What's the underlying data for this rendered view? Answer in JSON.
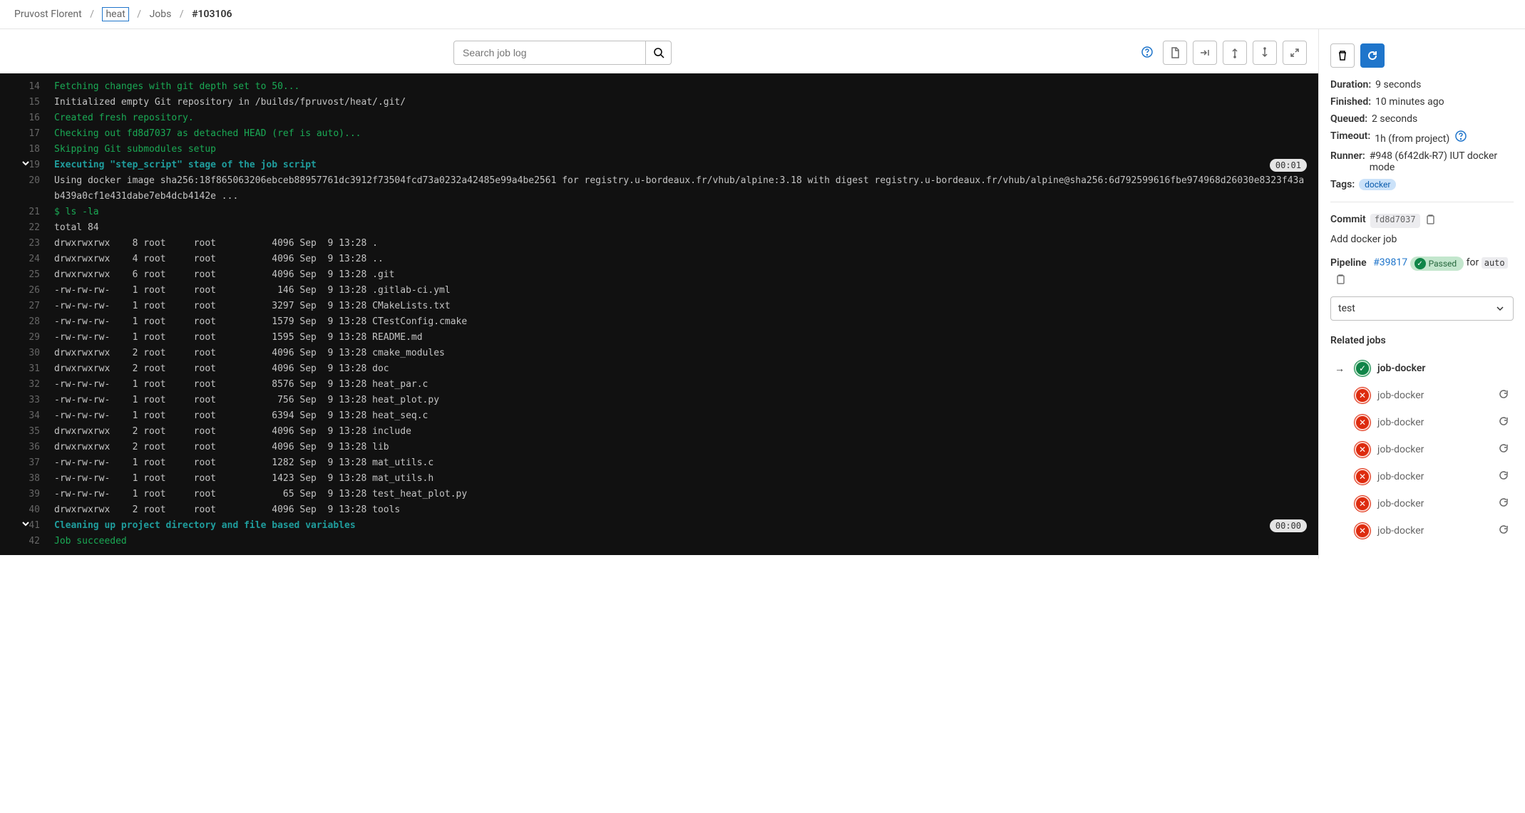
{
  "breadcrumb": {
    "owner": "Pruvost Florent",
    "project": "heat",
    "section": "Jobs",
    "job_id": "#103106"
  },
  "toolbar": {
    "search_placeholder": "Search job log"
  },
  "log": {
    "lines": [
      {
        "n": "14",
        "text": "Fetching changes with git depth set to 50...",
        "cls": "log-green",
        "chevron": false
      },
      {
        "n": "15",
        "text": "Initialized empty Git repository in /builds/fpruvost/heat/.git/",
        "cls": "",
        "chevron": false
      },
      {
        "n": "16",
        "text": "Created fresh repository.",
        "cls": "log-green",
        "chevron": false
      },
      {
        "n": "17",
        "text": "Checking out fd8d7037 as detached HEAD (ref is auto)...",
        "cls": "log-green",
        "chevron": false
      },
      {
        "n": "18",
        "text": "Skipping Git submodules setup",
        "cls": "log-green",
        "chevron": false
      },
      {
        "n": "19",
        "text": "Executing \"step_script\" stage of the job script",
        "cls": "log-cyan",
        "chevron": true,
        "duration": "00:01"
      },
      {
        "n": "20",
        "text": "Using docker image sha256:18f865063206ebceb88957761dc3912f73504fcd73a0232a42485e99a4be2561 for registry.u-bordeaux.fr/vhub/alpine:3.18 with digest registry.u-bordeaux.fr/vhub/alpine@sha256:6d792599616fbe974968d26030e8323f43ab439a0cf1e431dabe7eb4dcb4142e ...",
        "cls": "",
        "chevron": false
      },
      {
        "n": "21",
        "text": "$ ls -la",
        "cls": "log-green",
        "chevron": false
      },
      {
        "n": "22",
        "text": "total 84",
        "cls": "",
        "chevron": false
      },
      {
        "n": "23",
        "text": "drwxrwxrwx    8 root     root          4096 Sep  9 13:28 .",
        "cls": "",
        "chevron": false
      },
      {
        "n": "24",
        "text": "drwxrwxrwx    4 root     root          4096 Sep  9 13:28 ..",
        "cls": "",
        "chevron": false
      },
      {
        "n": "25",
        "text": "drwxrwxrwx    6 root     root          4096 Sep  9 13:28 .git",
        "cls": "",
        "chevron": false
      },
      {
        "n": "26",
        "text": "-rw-rw-rw-    1 root     root           146 Sep  9 13:28 .gitlab-ci.yml",
        "cls": "",
        "chevron": false
      },
      {
        "n": "27",
        "text": "-rw-rw-rw-    1 root     root          3297 Sep  9 13:28 CMakeLists.txt",
        "cls": "",
        "chevron": false
      },
      {
        "n": "28",
        "text": "-rw-rw-rw-    1 root     root          1579 Sep  9 13:28 CTestConfig.cmake",
        "cls": "",
        "chevron": false
      },
      {
        "n": "29",
        "text": "-rw-rw-rw-    1 root     root          1595 Sep  9 13:28 README.md",
        "cls": "",
        "chevron": false
      },
      {
        "n": "30",
        "text": "drwxrwxrwx    2 root     root          4096 Sep  9 13:28 cmake_modules",
        "cls": "",
        "chevron": false
      },
      {
        "n": "31",
        "text": "drwxrwxrwx    2 root     root          4096 Sep  9 13:28 doc",
        "cls": "",
        "chevron": false
      },
      {
        "n": "32",
        "text": "-rw-rw-rw-    1 root     root          8576 Sep  9 13:28 heat_par.c",
        "cls": "",
        "chevron": false
      },
      {
        "n": "33",
        "text": "-rw-rw-rw-    1 root     root           756 Sep  9 13:28 heat_plot.py",
        "cls": "",
        "chevron": false
      },
      {
        "n": "34",
        "text": "-rw-rw-rw-    1 root     root          6394 Sep  9 13:28 heat_seq.c",
        "cls": "",
        "chevron": false
      },
      {
        "n": "35",
        "text": "drwxrwxrwx    2 root     root          4096 Sep  9 13:28 include",
        "cls": "",
        "chevron": false
      },
      {
        "n": "36",
        "text": "drwxrwxrwx    2 root     root          4096 Sep  9 13:28 lib",
        "cls": "",
        "chevron": false
      },
      {
        "n": "37",
        "text": "-rw-rw-rw-    1 root     root          1282 Sep  9 13:28 mat_utils.c",
        "cls": "",
        "chevron": false
      },
      {
        "n": "38",
        "text": "-rw-rw-rw-    1 root     root          1423 Sep  9 13:28 mat_utils.h",
        "cls": "",
        "chevron": false
      },
      {
        "n": "39",
        "text": "-rw-rw-rw-    1 root     root            65 Sep  9 13:28 test_heat_plot.py",
        "cls": "",
        "chevron": false
      },
      {
        "n": "40",
        "text": "drwxrwxrwx    2 root     root          4096 Sep  9 13:28 tools",
        "cls": "",
        "chevron": false
      },
      {
        "n": "41",
        "text": "Cleaning up project directory and file based variables",
        "cls": "log-cyan",
        "chevron": true,
        "duration": "00:00"
      },
      {
        "n": "42",
        "text": "Job succeeded",
        "cls": "log-green",
        "chevron": false
      }
    ]
  },
  "sidebar": {
    "duration_label": "Duration:",
    "duration_value": "9 seconds",
    "finished_label": "Finished:",
    "finished_value": "10 minutes ago",
    "queued_label": "Queued:",
    "queued_value": "2 seconds",
    "timeout_label": "Timeout:",
    "timeout_value": "1h (from project)",
    "runner_label": "Runner:",
    "runner_value": "#948 (6f42dk-R7) IUT docker mode",
    "tags_label": "Tags:",
    "tag_value": "docker",
    "commit_label": "Commit",
    "commit_sha": "fd8d7037",
    "commit_msg": "Add docker job",
    "pipeline_label": "Pipeline",
    "pipeline_id": "#39817",
    "pipeline_status": "Passed",
    "pipeline_for": "for",
    "pipeline_ref": "auto",
    "stage_selected": "test",
    "related_title": "Related jobs",
    "jobs": [
      {
        "name": "job-docker",
        "status": "pass",
        "active": true,
        "retry": false
      },
      {
        "name": "job-docker",
        "status": "fail",
        "active": false,
        "retry": true
      },
      {
        "name": "job-docker",
        "status": "fail",
        "active": false,
        "retry": true
      },
      {
        "name": "job-docker",
        "status": "fail",
        "active": false,
        "retry": true
      },
      {
        "name": "job-docker",
        "status": "fail",
        "active": false,
        "retry": true
      },
      {
        "name": "job-docker",
        "status": "fail",
        "active": false,
        "retry": true
      },
      {
        "name": "job-docker",
        "status": "fail",
        "active": false,
        "retry": true
      }
    ]
  }
}
